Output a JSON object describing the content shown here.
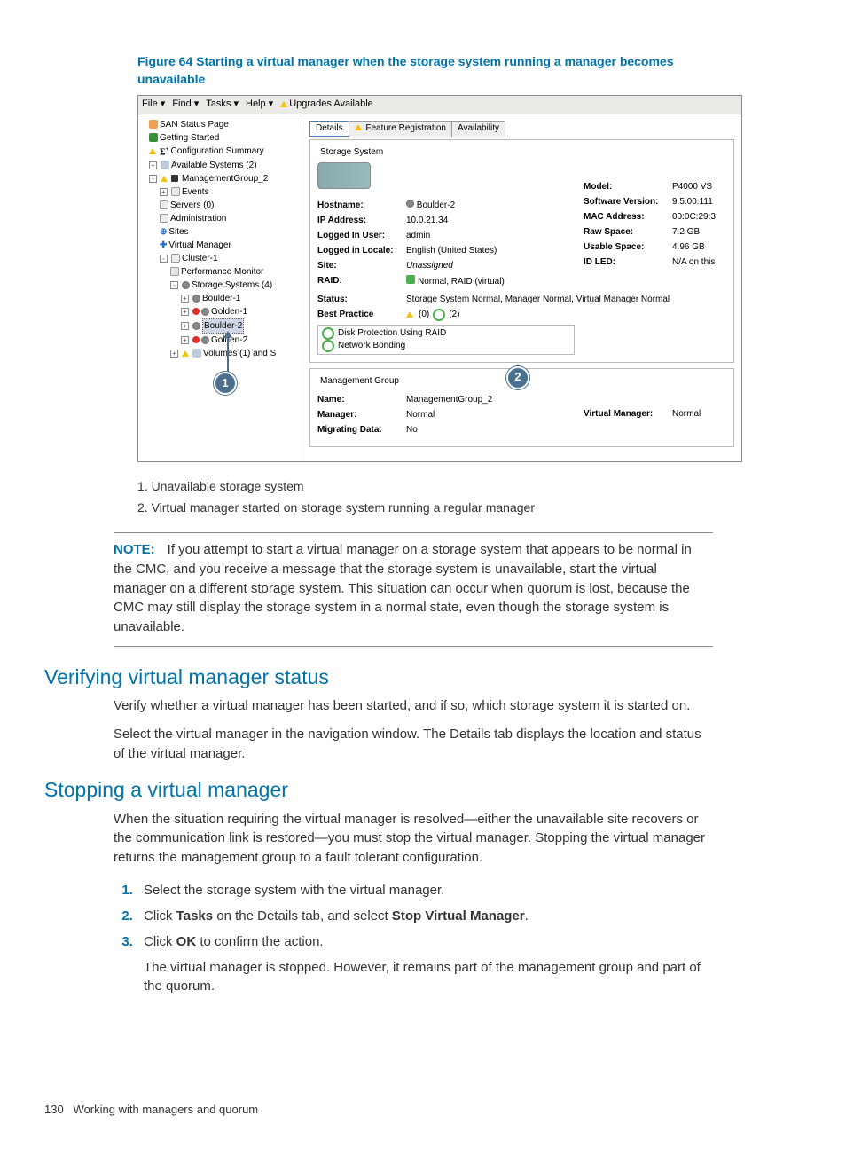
{
  "figure": {
    "title": "Figure 64 Starting a virtual manager when the storage system running a manager becomes unavailable"
  },
  "screenshot": {
    "menubar": {
      "file": "File",
      "find": "Find",
      "tasks": "Tasks",
      "help": "Help",
      "upgrades": "Upgrades Available"
    },
    "tree": {
      "san_status": "SAN Status Page",
      "getting_started": "Getting Started",
      "config_summary": "Configuration Summary",
      "available_systems": "Available Systems (2)",
      "mgmt_group": "ManagementGroup_2",
      "events": "Events",
      "servers": "Servers (0)",
      "administration": "Administration",
      "sites": "Sites",
      "virtual_manager": "Virtual Manager",
      "cluster": "Cluster-1",
      "perf_monitor": "Performance Monitor",
      "storage_systems": "Storage Systems (4)",
      "boulder1": "Boulder-1",
      "golden1": "Golden-1",
      "boulder2": "Boulder-2",
      "golden2": "Golden-2",
      "volumes": "Volumes (1) and S"
    },
    "tabs": {
      "details": "Details",
      "feature_reg": "Feature Registration",
      "availability": "Availability"
    },
    "storage_system": {
      "title": "Storage System",
      "hostname_k": "Hostname:",
      "hostname_v": "Boulder-2",
      "ip_k": "IP Address:",
      "ip_v": "10.0.21.34",
      "user_k": "Logged In User:",
      "user_v": "admin",
      "locale_k": "Logged in Locale:",
      "locale_v": "English (United States)",
      "site_k": "Site:",
      "site_v": "Unassigned",
      "raid_k": "RAID:",
      "raid_v": "Normal, RAID (virtual)",
      "status_k": "Status:",
      "status_v": "Storage System Normal, Manager Normal, Virtual Manager Normal",
      "bp_label": "Best Practice",
      "bp_count1": "(0)",
      "bp_count2": "(2)",
      "bp_item1": "Disk Protection Using RAID",
      "bp_item2": "Network Bonding",
      "model_k": "Model:",
      "model_v": "P4000 VS",
      "sw_k": "Software Version:",
      "sw_v": "9.5.00.111",
      "mac_k": "MAC Address:",
      "mac_v": "00:0C:29:3",
      "raw_k": "Raw Space:",
      "raw_v": "7.2 GB",
      "usable_k": "Usable Space:",
      "usable_v": "4.96 GB",
      "idled_k": "ID LED:",
      "idled_v": "N/A on this"
    },
    "mgmt_group_section": {
      "title": "Management Group",
      "name_k": "Name:",
      "name_v": "ManagementGroup_2",
      "manager_k": "Manager:",
      "manager_v": "Normal",
      "vm_k": "Virtual Manager:",
      "vm_v": "Normal",
      "mig_k": "Migrating Data:",
      "mig_v": "No"
    },
    "callouts": {
      "c1": "1",
      "c2": "2"
    }
  },
  "legend": {
    "l1": "1. Unavailable storage system",
    "l2": "2. Virtual manager started on storage system running a regular manager"
  },
  "note": {
    "label": "NOTE:",
    "text": "If you attempt to start a virtual manager on a storage system that appears to be normal in the CMC, and you receive a message that the storage system is unavailable, start the virtual manager on a different storage system. This situation can occur when quorum is lost, because the CMC may still display the storage system in a normal state, even though the storage system is unavailable."
  },
  "sections": {
    "verify_title": "Verifying virtual manager status",
    "verify_p1": "Verify whether a virtual manager has been started, and if so, which storage system it is started on.",
    "verify_p2": "Select the virtual manager in the navigation window. The Details tab displays the location and status of the virtual manager.",
    "stop_title": "Stopping a virtual manager",
    "stop_p1": "When the situation requiring the virtual manager is resolved—either the unavailable site recovers or the communication link is restored—you must stop the virtual manager. Stopping the virtual manager returns the management group to a fault tolerant configuration.",
    "step1": "Select the storage system with the virtual manager.",
    "step2_a": "Click ",
    "step2_b": "Tasks",
    "step2_c": " on the Details tab, and select ",
    "step2_d": "Stop Virtual Manager",
    "step2_e": ".",
    "step3_a": "Click ",
    "step3_b": "OK",
    "step3_c": " to confirm the action.",
    "step_tail": "The virtual manager is stopped. However, it remains part of the management group and part of the quorum."
  },
  "footer": {
    "page": "130",
    "title": "Working with managers and quorum"
  }
}
